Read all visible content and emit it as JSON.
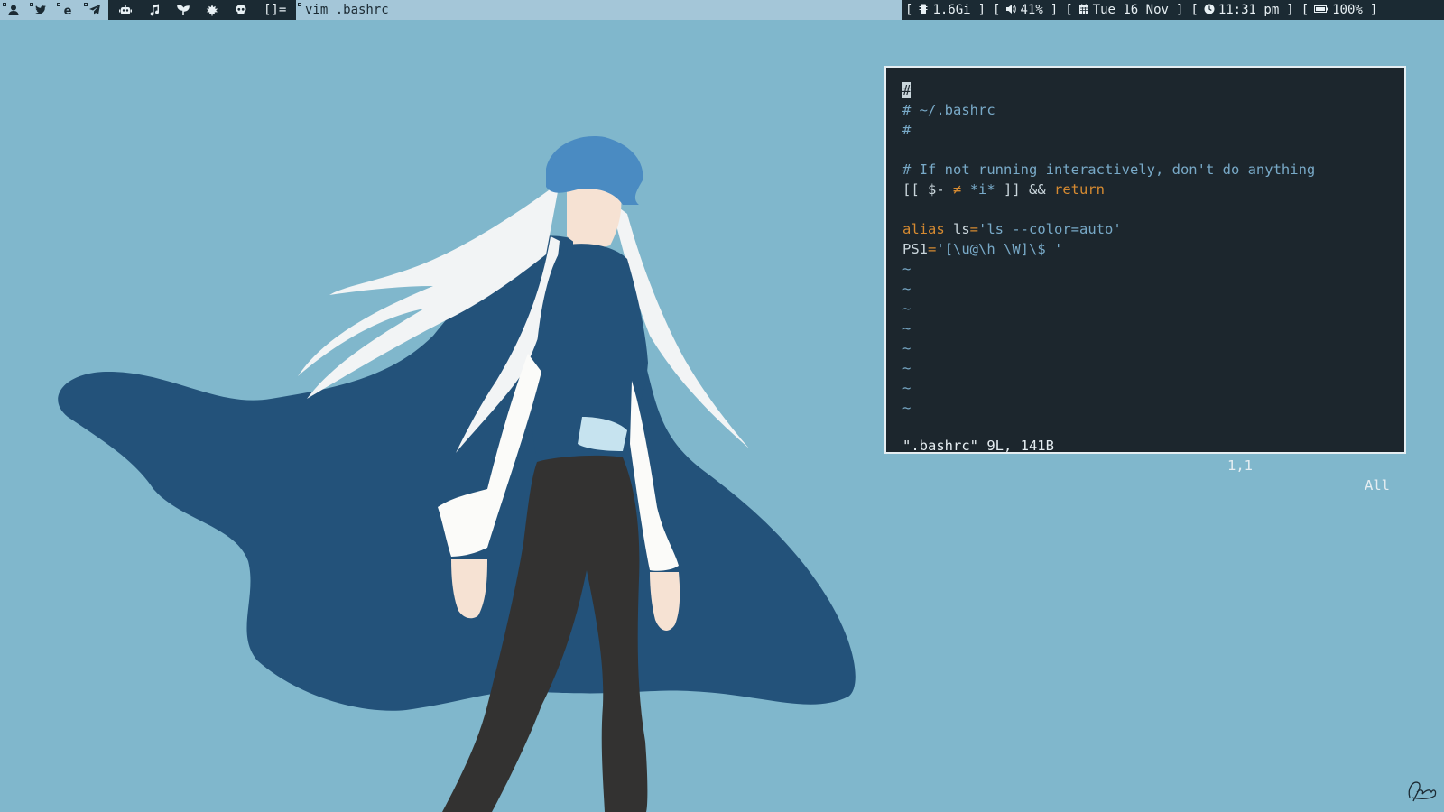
{
  "bar": {
    "workspaces": [
      {
        "icon": "user-icon"
      },
      {
        "icon": "bird-icon"
      },
      {
        "icon": "browser-e-icon"
      },
      {
        "icon": "paper-plane-icon"
      },
      {
        "icon": "robot-icon"
      },
      {
        "icon": "music-note-icon"
      },
      {
        "icon": "seedling-icon"
      },
      {
        "icon": "leaf-icon"
      },
      {
        "icon": "skull-icon"
      }
    ],
    "layout_symbol": "[]=",
    "window_title": "vim .bashrc",
    "status": {
      "memory": "1.6Gi",
      "volume": "41%",
      "date": "Tue 16 Nov",
      "time": "11:31 pm",
      "battery": "100%",
      "open_bracket": "[",
      "close_bracket": "]"
    }
  },
  "vim": {
    "lines": {
      "l1": "#",
      "l2": "# ~/.bashrc",
      "l3": "#",
      "l5": "# If not running interactively, don't do anything",
      "l6a": "[[ $- ",
      "l6b": "≠",
      "l6c": " *i* ",
      "l6d": "]] && ",
      "l6e": "return",
      "l8a": "alias",
      "l8b": " ls",
      "l8c": "=",
      "l8d": "'ls --color=auto'",
      "l9a": "PS1",
      "l9b": "=",
      "l9c": "'[\\u@\\h \\W]\\$ '"
    },
    "tilde": "~",
    "status_file": "\".bashrc\" 9L, 141B",
    "status_pos": "1,1",
    "status_view": "All"
  },
  "colors": {
    "desktop_bg": "#80b7cc",
    "bar_bg": "#a4c6d8",
    "bar_dark": "#1b2a33",
    "terminal_bg": "#1c262d",
    "comment": "#78a9c7",
    "keyword": "#d58a31",
    "cape": "#23527a",
    "hat": "#4a8bc2"
  }
}
